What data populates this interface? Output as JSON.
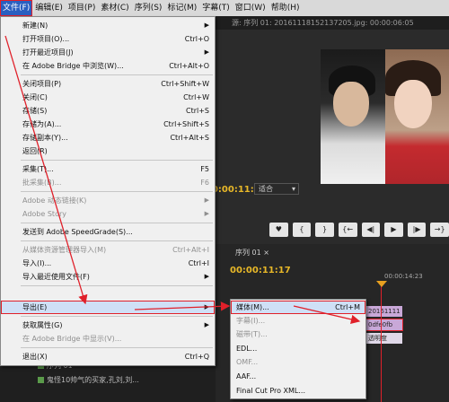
{
  "menubar": {
    "items": [
      "文件(F)",
      "编辑(E)",
      "项目(P)",
      "素材(C)",
      "序列(S)",
      "标记(M)",
      "字幕(T)",
      "窗口(W)",
      "帮助(H)"
    ]
  },
  "monitor": {
    "tab_title": "源: 序列 01: 20161118152137205.jpg: 00:00:06:05",
    "timecode": "00:00:11:17",
    "fit_select": "适合"
  },
  "transport": {
    "buttons": [
      "♥",
      "{",
      "}",
      "{←",
      "◀|",
      "▶",
      "|▶",
      "→}"
    ]
  },
  "sequence": {
    "tab": "序列 01 ×",
    "timecode": "00:00:11:17",
    "ruler_time": "00:00:14:23",
    "clips": [
      "20161111",
      "0dfe0fb",
      "透明度"
    ]
  },
  "project": {
    "rows": [
      "序列 01",
      "鬼怪10帅气的买家,孔刘,刘..."
    ]
  },
  "file_menu": {
    "items": [
      {
        "label": "新建(N)",
        "shortcut": "",
        "submenu": true,
        "disabled": false
      },
      {
        "label": "打开项目(O)...",
        "shortcut": "Ctrl+O",
        "submenu": false,
        "disabled": false
      },
      {
        "label": "打开最近项目(J)",
        "shortcut": "",
        "submenu": true,
        "disabled": false
      },
      {
        "label": "在 Adobe Bridge 中浏览(W)...",
        "shortcut": "Ctrl+Alt+O",
        "submenu": false,
        "disabled": false
      },
      {
        "label": "关闭项目(P)",
        "shortcut": "Ctrl+Shift+W",
        "submenu": false,
        "disabled": false
      },
      {
        "label": "关闭(C)",
        "shortcut": "Ctrl+W",
        "submenu": false,
        "disabled": false
      },
      {
        "label": "存储(S)",
        "shortcut": "Ctrl+S",
        "submenu": false,
        "disabled": false
      },
      {
        "label": "存储为(A)...",
        "shortcut": "Ctrl+Shift+S",
        "submenu": false,
        "disabled": false
      },
      {
        "label": "存储副本(Y)...",
        "shortcut": "Ctrl+Alt+S",
        "submenu": false,
        "disabled": false
      },
      {
        "label": "返回(R)",
        "shortcut": "",
        "submenu": false,
        "disabled": false
      },
      {
        "label": "采集(T)...",
        "shortcut": "F5",
        "submenu": false,
        "disabled": false
      },
      {
        "label": "批采集(B)...",
        "shortcut": "F6",
        "submenu": false,
        "disabled": true
      },
      {
        "label": "Adobe 动态链接(K)",
        "shortcut": "",
        "submenu": true,
        "disabled": true
      },
      {
        "label": "Adobe Story",
        "shortcut": "",
        "submenu": true,
        "disabled": true
      },
      {
        "label": "发送到 Adobe SpeedGrade(S)...",
        "shortcut": "",
        "submenu": false,
        "disabled": false
      },
      {
        "label": "从媒体资源管理器导入(M)",
        "shortcut": "Ctrl+Alt+I",
        "submenu": false,
        "disabled": true
      },
      {
        "label": "导入(I)...",
        "shortcut": "Ctrl+I",
        "submenu": false,
        "disabled": false
      },
      {
        "label": "导入最近使用文件(F)",
        "shortcut": "",
        "submenu": true,
        "disabled": false
      },
      {
        "label": "导出(E)",
        "shortcut": "",
        "submenu": true,
        "disabled": false
      },
      {
        "label": "获取属性(G)",
        "shortcut": "",
        "submenu": true,
        "disabled": false
      },
      {
        "label": "在 Adobe Bridge 中显示(V)...",
        "shortcut": "",
        "submenu": false,
        "disabled": true
      },
      {
        "label": "退出(X)",
        "shortcut": "Ctrl+Q",
        "submenu": false,
        "disabled": false
      }
    ]
  },
  "export_menu": {
    "items": [
      {
        "label": "媒体(M)...",
        "shortcut": "Ctrl+M",
        "disabled": false
      },
      {
        "label": "字幕(I)...",
        "shortcut": "",
        "disabled": true
      },
      {
        "label": "磁带(T)...",
        "shortcut": "",
        "disabled": true
      },
      {
        "label": "EDL...",
        "shortcut": "",
        "disabled": false
      },
      {
        "label": "OMF...",
        "shortcut": "",
        "disabled": true
      },
      {
        "label": "AAF...",
        "shortcut": "",
        "disabled": false
      },
      {
        "label": "Final Cut Pro XML...",
        "shortcut": "",
        "disabled": false
      }
    ]
  },
  "colors": {
    "menu_bg": "#f0f0f0",
    "highlight": "#cfe0f6",
    "annotation_red": "#e0202a",
    "timecode": "#e8b828"
  }
}
